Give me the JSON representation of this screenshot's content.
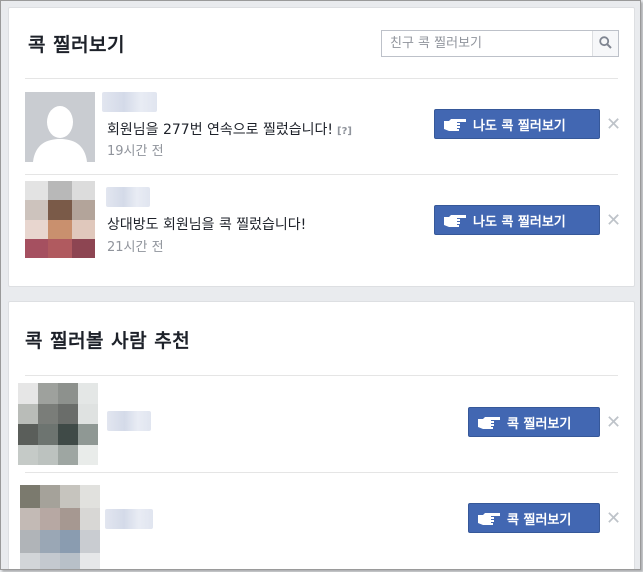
{
  "pokes": {
    "title": "콕 찔러보기",
    "search_placeholder": "친구 콕 찔러보기",
    "items": [
      {
        "message": "회원님을 277번 연속으로 찔렀습니다!",
        "help": "[?]",
        "time": "19시간 전",
        "button_label": "나도 콕 찔러보기"
      },
      {
        "message": "상대방도 회원님을 콕 찔렀습니다!",
        "time": "21시간 전",
        "button_label": "나도 콕 찔러보기"
      }
    ]
  },
  "suggestions": {
    "title": "콕 찔러볼 사람 추천",
    "items": [
      {
        "button_label": "콕 찔러보기"
      },
      {
        "button_label": "콕 찔러보기"
      }
    ]
  },
  "icons": {
    "poke": "pointing-hand-icon",
    "close": "close-icon",
    "search": "search-icon"
  },
  "colors": {
    "button_blue": "#4267b2",
    "timestamp": "#90949c",
    "close": "#bec3c9"
  },
  "close_glyph": "✕"
}
